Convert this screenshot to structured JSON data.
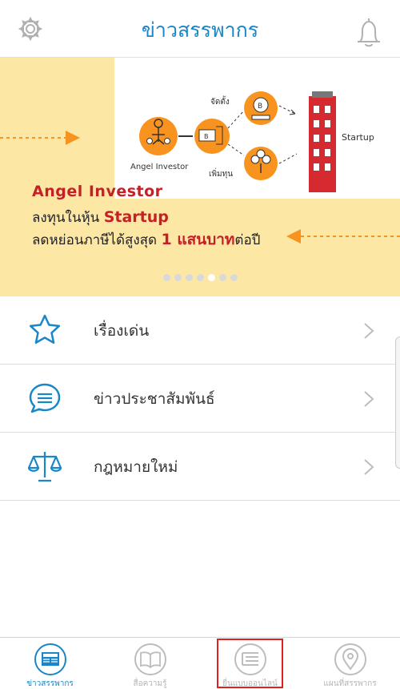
{
  "header": {
    "title": "ข่าวสรรพากร",
    "left_icon": "gear-icon",
    "right_icon": "bell-icon"
  },
  "banner": {
    "image_labels": {
      "angel": "Angel Investor",
      "startup": "Startup",
      "invest": "จัดตั้ง",
      "add": "เพิ่มทุน"
    },
    "line1": "Angel Investor",
    "line2_prefix": "ลงทุนในหุ้น ",
    "line2_highlight": "Startup",
    "line3_prefix": "ลดหย่อนภาษีได้สูงสุด ",
    "line3_highlight": "1 แสนบาท",
    "line3_suffix": "ต่อปี",
    "slide_count": 7,
    "active_slide": 4
  },
  "menu": {
    "items": [
      {
        "label": "เรื่องเด่น",
        "icon": "star-icon"
      },
      {
        "label": "ข่าวประชาสัมพันธ์",
        "icon": "chat-bubble-icon"
      },
      {
        "label": "กฎหมายใหม่",
        "icon": "scales-icon"
      }
    ]
  },
  "tabbar": {
    "tabs": [
      {
        "label": "ข่าวสรรพากร",
        "icon": "news-icon",
        "active": true
      },
      {
        "label": "สื่อความรู้",
        "icon": "book-icon",
        "active": false
      },
      {
        "label": "ยื่นแบบออนไลน์",
        "icon": "form-list-icon",
        "active": false
      },
      {
        "label": "แผนที่สรรพากร",
        "icon": "map-pin-icon",
        "active": false
      }
    ]
  },
  "colors": {
    "brand_blue": "#1a86c7",
    "banner_bg": "#fde7a4",
    "accent_red": "#c62027",
    "orange": "#f7931e"
  }
}
